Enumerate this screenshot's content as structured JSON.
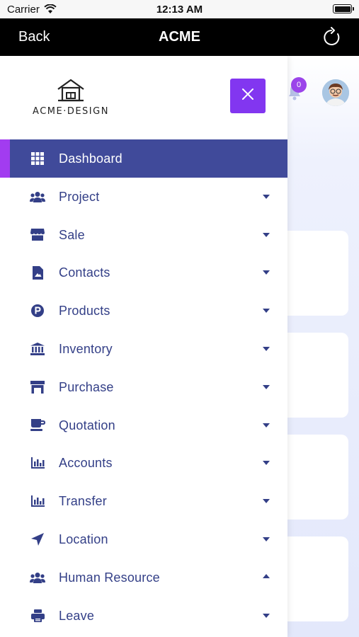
{
  "status_bar": {
    "carrier": "Carrier",
    "time": "12:13 AM"
  },
  "nav": {
    "back_label": "Back",
    "title": "ACME"
  },
  "header": {
    "notification_count": "0"
  },
  "logo": {
    "text": "ACME·DESIGN"
  },
  "menu": {
    "items": [
      {
        "label": "Dashboard",
        "icon": "grid-icon",
        "active": true,
        "caret": "none"
      },
      {
        "label": "Project",
        "icon": "users-icon",
        "caret": "down"
      },
      {
        "label": "Sale",
        "icon": "store-icon",
        "caret": "down"
      },
      {
        "label": "Contacts",
        "icon": "contact-file-icon",
        "caret": "down"
      },
      {
        "label": "Products",
        "icon": "product-p-icon",
        "caret": "down"
      },
      {
        "label": "Inventory",
        "icon": "bank-icon",
        "caret": "down"
      },
      {
        "label": "Purchase",
        "icon": "shop-icon",
        "caret": "down"
      },
      {
        "label": "Quotation",
        "icon": "mug-icon",
        "caret": "down"
      },
      {
        "label": "Accounts",
        "icon": "bar-chart-icon",
        "caret": "down"
      },
      {
        "label": "Transfer",
        "icon": "bar-chart-icon",
        "caret": "down"
      },
      {
        "label": "Location",
        "icon": "location-arrow-icon",
        "caret": "down"
      },
      {
        "label": "Human Resource",
        "icon": "users-icon",
        "caret": "up"
      },
      {
        "label": "Leave",
        "icon": "print-icon",
        "caret": "down"
      }
    ]
  },
  "colors": {
    "nav_bg": "#000000",
    "drawer_active": "#404a9a",
    "accent": "#8236f0",
    "menu_text": "#333f87",
    "badge": "#9b44ea"
  }
}
